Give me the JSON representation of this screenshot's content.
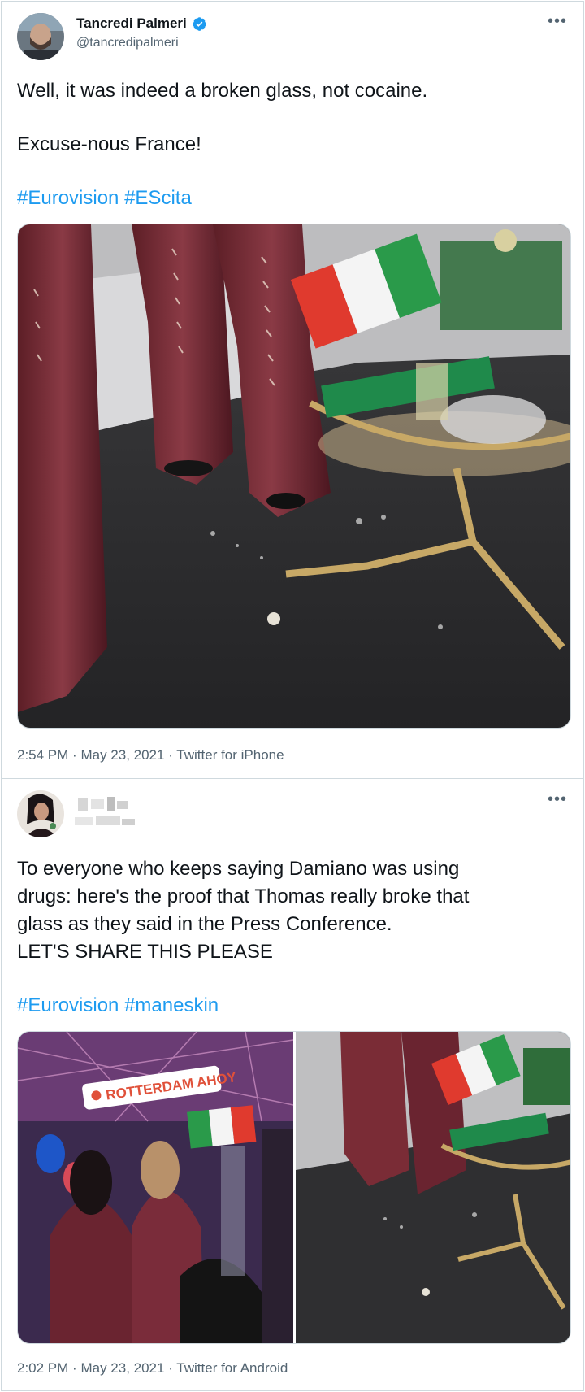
{
  "tweets": [
    {
      "author": {
        "name": "Tancredi Palmeri",
        "handle": "@tancredipalmeri",
        "verified": true
      },
      "lines": [
        "Well, it was indeed a broken glass, not cocaine.",
        "Excuse-nous France!"
      ],
      "hashtags": [
        "#Eurovision",
        "#EScita"
      ],
      "meta": {
        "time": "2:54 PM",
        "date": "May 23, 2021",
        "source": "Twitter for iPhone"
      },
      "more_icon": "ellipsis-icon"
    },
    {
      "author": {
        "name_blurred": true
      },
      "lines": [
        "To everyone who keeps saying Damiano was using",
        "drugs: here's the proof that Thomas really broke that",
        "glass as they said in the Press Conference.",
        "LET'S SHARE THIS PLEASE"
      ],
      "hashtags": [
        "#Eurovision",
        "#maneskin"
      ],
      "media_overlay_text": "ROTTERDAM AHOY",
      "meta": {
        "time": "2:02 PM",
        "date": "May 23, 2021",
        "source": "Twitter for Android"
      },
      "more_icon": "ellipsis-icon"
    }
  ],
  "separator": "·",
  "colors": {
    "accent": "#1d9bf0",
    "border": "#cfd9de",
    "secondary": "#536471"
  }
}
